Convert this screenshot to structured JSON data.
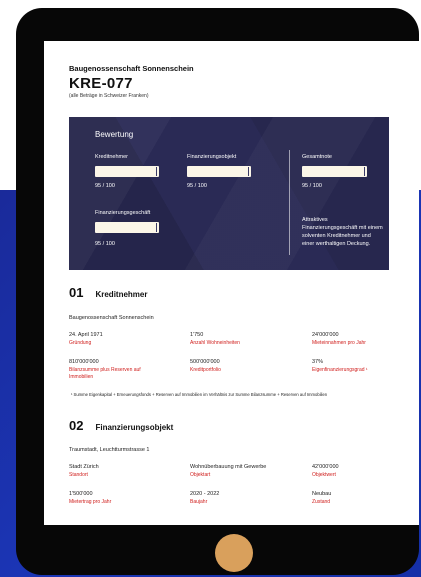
{
  "header": {
    "org": "Baugenossenschaft Sonnenschein",
    "code": "KRE-077",
    "note": "(alle Beträge in Schweizer Franken)"
  },
  "rating": {
    "title": "Bewertung",
    "items": [
      {
        "label": "Kreditnehmer",
        "value": "95 / 100",
        "fill": 0.95
      },
      {
        "label": "Finanzierungsobjekt",
        "value": "95 / 100",
        "fill": 0.95
      },
      {
        "label": "Gesamtnote",
        "value": "95 / 100",
        "fill": 0.95
      },
      {
        "label": "Finanzierungsgeschäft",
        "value": "95 / 100",
        "fill": 0.95
      }
    ],
    "summary": "Attraktives Finanzierungsgeschäft mit einem solventen Kreditnehmer und einer werthaltigen Deckung."
  },
  "section1": {
    "num": "01",
    "title": "Kreditnehmer",
    "subtitle": "Baugenossenschaft Sonnenschein",
    "cells": [
      {
        "value": "24. April 1971",
        "label": "Gründung"
      },
      {
        "value": "1'750",
        "label": "Anzahl Wohneinheiten"
      },
      {
        "value": "24'000'000",
        "label": "Mieteinnahmen pro Jahr"
      },
      {
        "value": "810'000'000",
        "label": "Bilanzsumme plus Reserven auf Immobilien"
      },
      {
        "value": "500'000'000",
        "label": "Kreditportfolio"
      },
      {
        "value": "37%",
        "label": "Eigenfinanzierungsgrad ¹"
      }
    ],
    "footnote": "¹  Summe Eigenkapital + Erneuerungsfonds + Reserven auf Immobilien im Verhältnis zur Summe Bilanzsumme + Reserven auf Immobilien"
  },
  "section2": {
    "num": "02",
    "title": "Finanzierungsobjekt",
    "subtitle": "Traumstadt, Leuchtturmstrasse 1",
    "cells": [
      {
        "value": "Stadt Zürich",
        "label": "Standort"
      },
      {
        "value": "Wohnüberbauung mit Gewerbe",
        "label": "Objektart"
      },
      {
        "value": "42'000'000",
        "label": "Objektwert"
      },
      {
        "value": "1'500'000",
        "label": "Mietertrag pro Jahr"
      },
      {
        "value": "2020 - 2022",
        "label": "Baujahr"
      },
      {
        "value": "Neubau",
        "label": "Zustand"
      }
    ]
  }
}
